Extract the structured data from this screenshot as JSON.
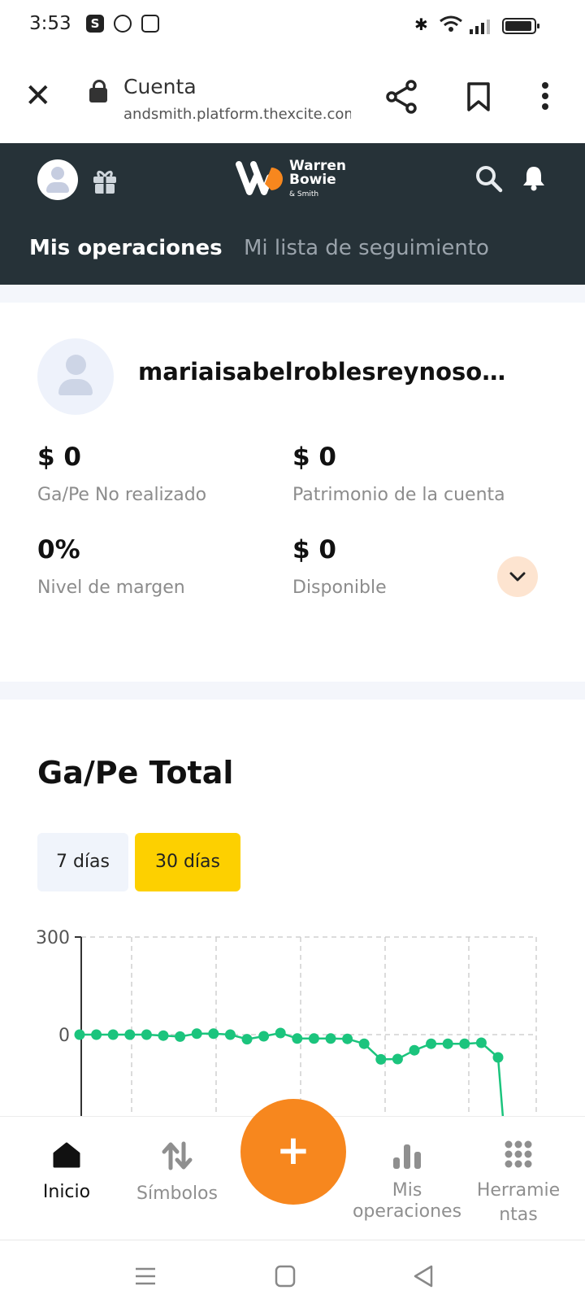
{
  "status_bar": {
    "time": "3:53",
    "app_icon_letter": "S"
  },
  "browser": {
    "page_title": "Cuenta",
    "url": "andsmith.platform.thexcite.com"
  },
  "app_header": {
    "logo": {
      "line1": "Warren",
      "line2": "Bowie",
      "line3": "& Smith"
    },
    "tabs": [
      {
        "label": "Mis operaciones",
        "active": true
      },
      {
        "label": "Mi lista de seguimiento",
        "active": false
      }
    ]
  },
  "account": {
    "email": "mariaisabelroblesreynoso@gmail.com",
    "stats": [
      {
        "value": "$ 0",
        "label": "Ga/Pe No realizado"
      },
      {
        "value": "$ 0",
        "label": "Patrimonio de la cuenta"
      },
      {
        "value": "0%",
        "label": "Nivel de margen"
      },
      {
        "value": "$ 0",
        "label": "Disponible"
      }
    ]
  },
  "pnl": {
    "title": "Ga/Pe Total",
    "ranges": [
      {
        "label": "7 días",
        "active": false
      },
      {
        "label": "30 días",
        "active": true
      }
    ]
  },
  "chart_data": {
    "type": "line",
    "title": "",
    "xlabel": "",
    "ylabel": "",
    "y_tick_labels": [
      "300",
      "0"
    ],
    "ylim": [
      -100,
      300
    ],
    "x": [
      1,
      2,
      3,
      4,
      5,
      6,
      7,
      8,
      9,
      10,
      11,
      12,
      13,
      14,
      15,
      16,
      17,
      18,
      19,
      20,
      21,
      22,
      23,
      24,
      25,
      26
    ],
    "series": [
      {
        "values": [
          0,
          0,
          0,
          0,
          0,
          -3,
          -6,
          3,
          3,
          0,
          -14,
          -5,
          5,
          -12,
          -12,
          -12,
          -13,
          -28,
          -76,
          -75,
          -48,
          -28,
          -28,
          -28,
          -25,
          -70
        ]
      }
    ],
    "line_color": "#1bc47d",
    "grid": true
  },
  "bottom_nav": {
    "items": [
      {
        "label": "Inicio",
        "active": true
      },
      {
        "label": "Símbolos",
        "active": false
      },
      {
        "label": "Mis operaciones",
        "active": false
      },
      {
        "label": "Herramientas",
        "active": false
      }
    ],
    "fab_symbol": "+"
  }
}
